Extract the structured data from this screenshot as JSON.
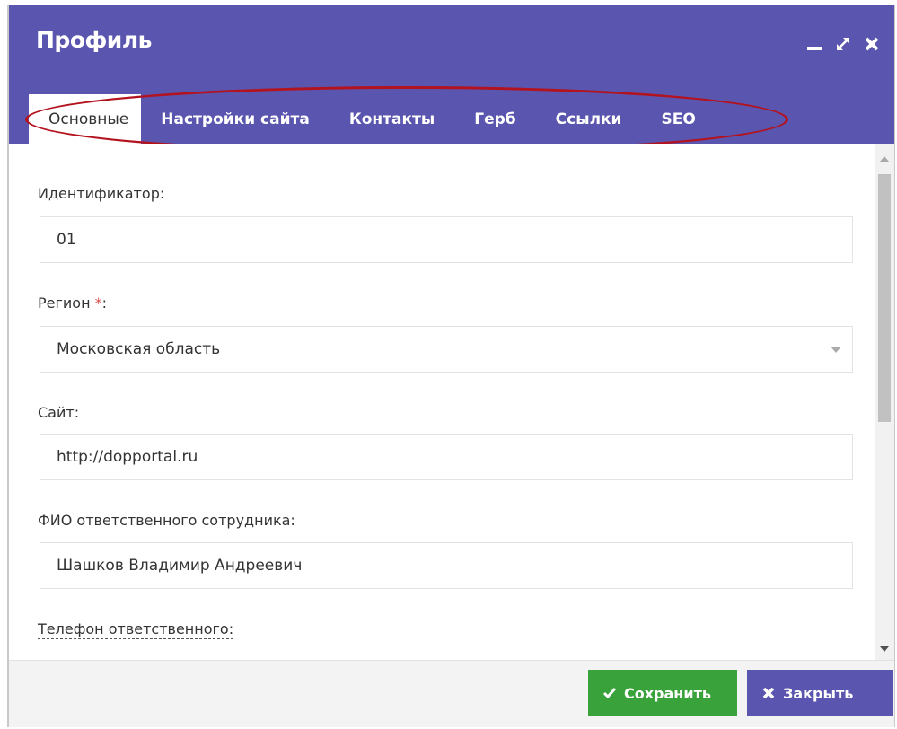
{
  "window": {
    "title": "Профиль"
  },
  "tabs": [
    {
      "label": "Основные",
      "active": true
    },
    {
      "label": "Настройки сайта",
      "active": false
    },
    {
      "label": "Контакты",
      "active": false
    },
    {
      "label": "Герб",
      "active": false
    },
    {
      "label": "Ссылки",
      "active": false
    },
    {
      "label": "SEO",
      "active": false
    }
  ],
  "form": {
    "identifier": {
      "label": "Идентификатор:",
      "value": "01"
    },
    "region": {
      "label": "Регион",
      "required_mark": "*",
      "suffix": ":",
      "value": "Московская область"
    },
    "site": {
      "label": "Сайт:",
      "value": "http://dopportal.ru"
    },
    "responsible": {
      "label": "ФИО ответственного сотрудника:",
      "value": "Шашков Владимир Андреевич"
    },
    "phone": {
      "label": "Телефон ответственного:",
      "value": ""
    }
  },
  "footer": {
    "save_label": "Сохранить",
    "close_label": "Закрыть"
  },
  "colors": {
    "header": "#5a55ae",
    "save_button": "#3aa23a",
    "close_button": "#5a55ae",
    "highlight": "#b3131f"
  }
}
